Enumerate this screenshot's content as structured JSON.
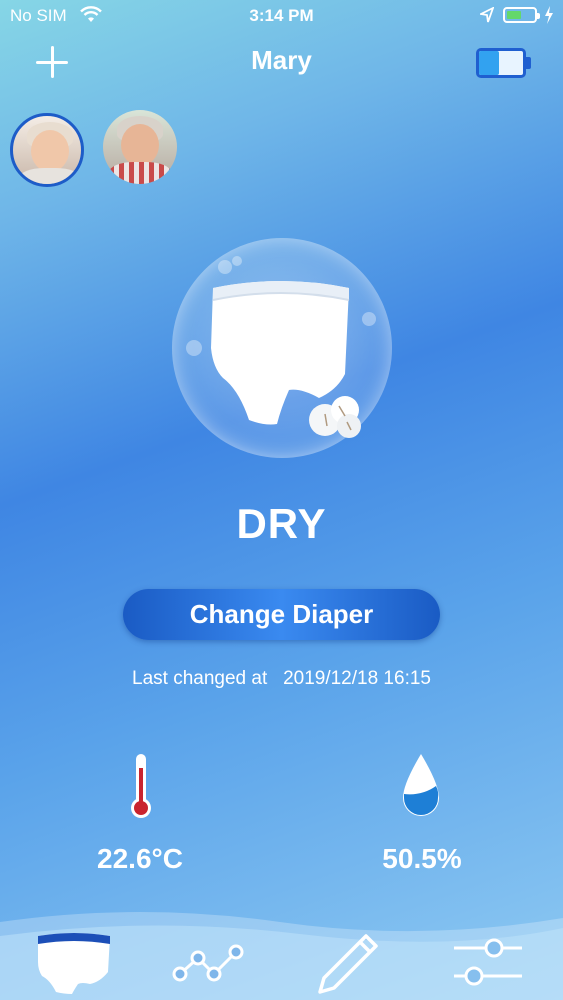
{
  "status_bar": {
    "carrier": "No SIM",
    "time": "3:14 PM"
  },
  "header": {
    "title": "Mary"
  },
  "icons": {
    "add": "plus-icon",
    "device_battery": "battery-icon",
    "diaper": "diaper-icon",
    "cotton": "cotton-icon",
    "thermometer": "thermometer-icon",
    "humidity": "water-drop-icon"
  },
  "profiles": [
    {
      "name": "avatar-elderly-woman",
      "selected": true
    },
    {
      "name": "avatar-elderly-man",
      "selected": false
    }
  ],
  "main": {
    "status": "DRY",
    "change_button_label": "Change Diaper",
    "last_changed_label": "Last changed at",
    "last_changed_value": "2019/12/18 16:15",
    "temperature": "22.6°C",
    "humidity": "50.5%"
  },
  "tabs": [
    {
      "name": "status",
      "icon": "diaper-icon",
      "active": true
    },
    {
      "name": "history",
      "icon": "chart-line-icon",
      "active": false
    },
    {
      "name": "notes",
      "icon": "pencil-icon",
      "active": false
    },
    {
      "name": "settings",
      "icon": "sliders-icon",
      "active": false
    }
  ],
  "colors": {
    "accent": "#1f5fd0",
    "background_top": "#86d6e6",
    "background_mid": "#3f86e3"
  }
}
